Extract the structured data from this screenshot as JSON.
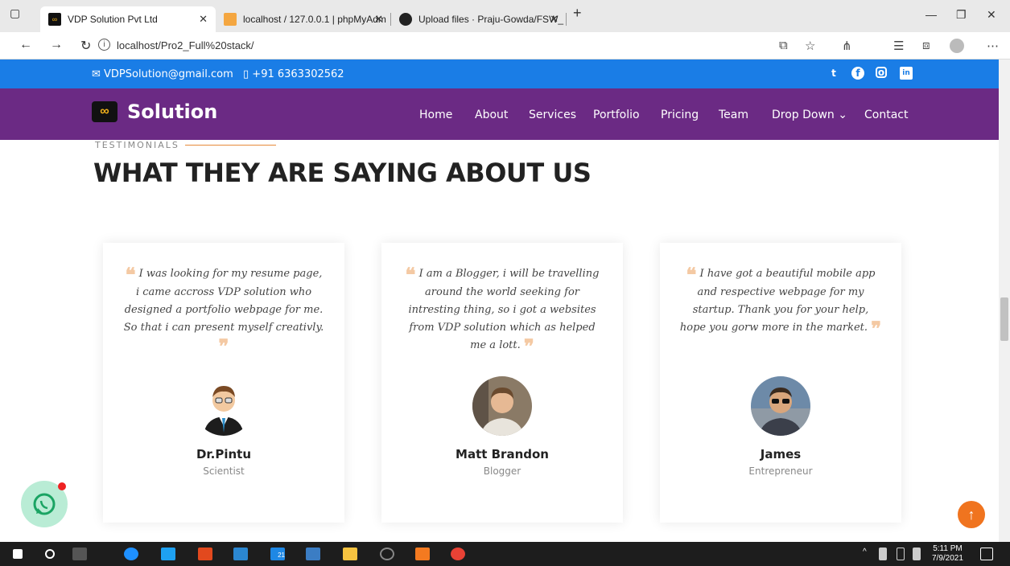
{
  "browser": {
    "tabs": [
      {
        "title": "VDP Solution Pvt Ltd"
      },
      {
        "title": "localhost / 127.0.0.1 | phpMyAdm"
      },
      {
        "title": "Upload files · Praju-Gowda/FSW_"
      }
    ],
    "url": "localhost/Pro2_Full%20stack/"
  },
  "site": {
    "email": "VDPSolution@gmail.com",
    "phone": "+91 6363302562",
    "logo": "Solution",
    "nav": [
      "Home",
      "About",
      "Services",
      "Portfolio",
      "Pricing",
      "Team",
      "Drop Down",
      "Contact"
    ]
  },
  "section": {
    "label": "TESTIMONIALS",
    "title": "WHAT THEY ARE SAYING ABOUT US"
  },
  "testimonials": [
    {
      "text": "I was looking for my resume page, i came accross VDP solution who designed a portfolio webpage for me. So that i can present myself creativly.",
      "name": "Dr.Pintu",
      "role": "Scientist"
    },
    {
      "text": "I am a Blogger, i will be travelling around the world seeking for intresting thing, so i got a websites from VDP solution which as helped me a lott.",
      "name": "Matt Brandon",
      "role": "Blogger"
    },
    {
      "text": "I have got a beautiful mobile app and respective webpage for my startup. Thank you for your help, hope you gorw more in the market.",
      "name": "James",
      "role": "Entrepreneur"
    }
  ],
  "taskbar": {
    "time": "5:11 PM",
    "date": "7/9/2021",
    "badge": "21"
  },
  "colors": {
    "topbar": "#1a7de6",
    "header": "#6b2a84",
    "accent": "#f0741f"
  }
}
